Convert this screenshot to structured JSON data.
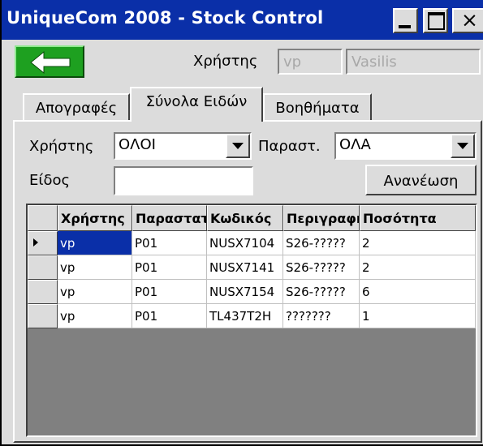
{
  "window": {
    "title": "UniqueCom 2008 - Stock Control",
    "title_bg": "#0a2fa8",
    "close_glyph": "×"
  },
  "toolbar": {
    "back_icon": "left-arrow-icon",
    "user_label": "Χρήστης",
    "user_code": "vp",
    "user_name": "Vasilis"
  },
  "tabs": [
    {
      "label": "Απογραφές",
      "active": false
    },
    {
      "label": "Σύνολα Ειδών",
      "active": true
    },
    {
      "label": "Βοηθήματα",
      "active": false
    }
  ],
  "filters": {
    "user_label": "Χρήστης",
    "user_value": "ΟΛΟΙ",
    "doc_label": "Παραστ.",
    "doc_value": "ΟΛΑ",
    "item_label": "Είδος",
    "item_value": "",
    "refresh_label": "Ανανέωση"
  },
  "grid": {
    "columns": [
      "Χρήστης",
      "Παραστατ",
      "Κωδικός",
      "Περιγραφή",
      "Ποσότητα"
    ],
    "rows": [
      [
        "vp",
        "P01",
        "NUSX7104",
        "S26-?????",
        "2"
      ],
      [
        "vp",
        "P01",
        "NUSX7141",
        "S26-?????",
        "2"
      ],
      [
        "vp",
        "P01",
        "NUSX7154",
        "S26-?????",
        "6"
      ],
      [
        "vp",
        "P01",
        "TL437T2H",
        "???????",
        "1"
      ]
    ],
    "selected_row": 0,
    "selection_color": "#0a2fa8"
  }
}
